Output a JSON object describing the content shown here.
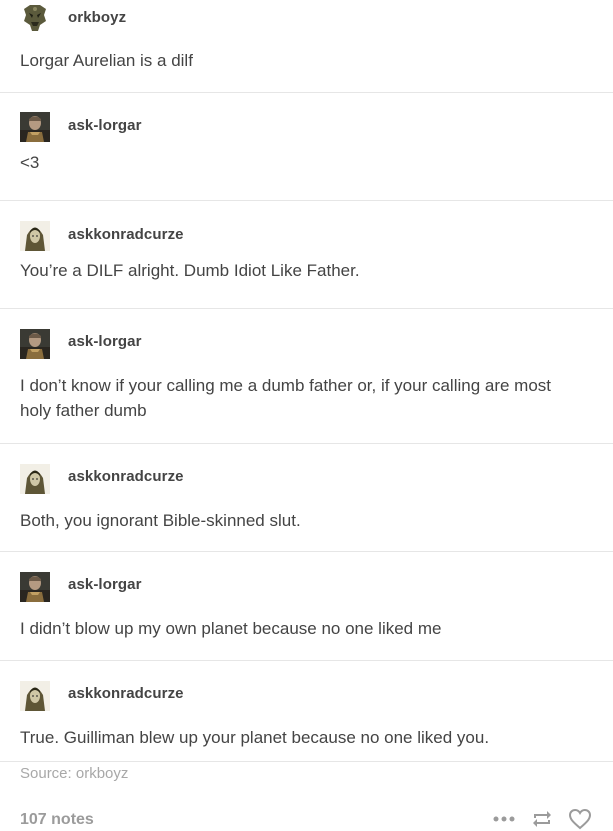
{
  "thread": [
    {
      "username": "orkboyz",
      "avatar": "ork-glyph-avatar-icon",
      "text": "Lorgar Aurelian is a dilf"
    },
    {
      "username": "ask-lorgar",
      "avatar": "lorgar-portrait-avatar-icon",
      "text": "<3"
    },
    {
      "username": "askkonradcurze",
      "avatar": "konrad-portrait-avatar-icon",
      "text": "You’re a DILF alright. Dumb Idiot Like Father."
    },
    {
      "username": "ask-lorgar",
      "avatar": "lorgar-portrait-avatar-icon",
      "text": "I don’t know if your calling me a dumb father or, if your calling are most holy father dumb"
    },
    {
      "username": "askkonradcurze",
      "avatar": "konrad-portrait-avatar-icon",
      "text": "Both, you ignorant Bible-skinned slut."
    },
    {
      "username": "ask-lorgar",
      "avatar": "lorgar-portrait-avatar-icon",
      "text": "I didn’t blow up my own planet because no one liked me"
    },
    {
      "username": "askkonradcurze",
      "avatar": "konrad-portrait-avatar-icon",
      "text": "True. Guilliman blew up your planet because no one liked you."
    }
  ],
  "source": "Source: orkboyz",
  "footer": {
    "notes": "107 notes",
    "icons": [
      "more-dots-icon",
      "reblog-icon",
      "heart-icon"
    ]
  },
  "colors": {
    "text": "#444444",
    "muted": "#a8a8a8",
    "divider": "#e6e6e6"
  }
}
